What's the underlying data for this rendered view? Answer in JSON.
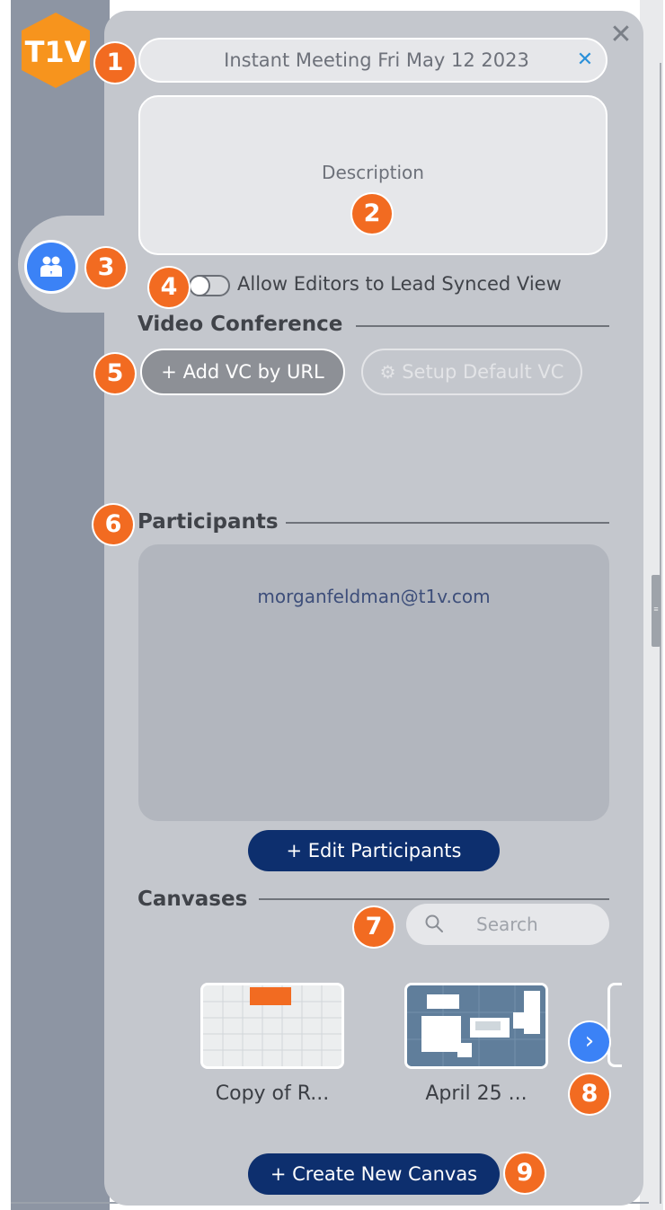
{
  "logo": {
    "text": "T1V",
    "color": "#f7941d"
  },
  "meeting": {
    "title": "Instant Meeting Fri May 12 2023",
    "clear_icon": "x-icon",
    "description_placeholder": "Description"
  },
  "close_icon": "close-icon",
  "side_tab": {
    "icon": "people-icon"
  },
  "toggle": {
    "label": "Allow Editors to Lead Synced View",
    "checked": false
  },
  "video_conference": {
    "title": "Video Conference",
    "add_vc_label": "+ Add VC by URL",
    "setup_default_label": "Setup Default VC",
    "setup_icon": "gear-icon"
  },
  "participants": {
    "title": "Participants",
    "emails": [
      "morganfeldman@t1v.com"
    ],
    "edit_label": "+  Edit Participants"
  },
  "canvases": {
    "title": "Canvases",
    "search_placeholder": "Search",
    "items": [
      {
        "label": "Copy of R..."
      },
      {
        "label": "April 25 ..."
      }
    ],
    "next_icon": "chevron-right-icon",
    "create_label": "+  Create New Canvas"
  },
  "callouts": [
    "1",
    "2",
    "3",
    "4",
    "5",
    "6",
    "7",
    "8",
    "9"
  ],
  "colors": {
    "panel": "#c4c7cd",
    "navy": "#0d2f6e",
    "callout": "#f26b21",
    "accent_blue": "#3b82f6"
  }
}
